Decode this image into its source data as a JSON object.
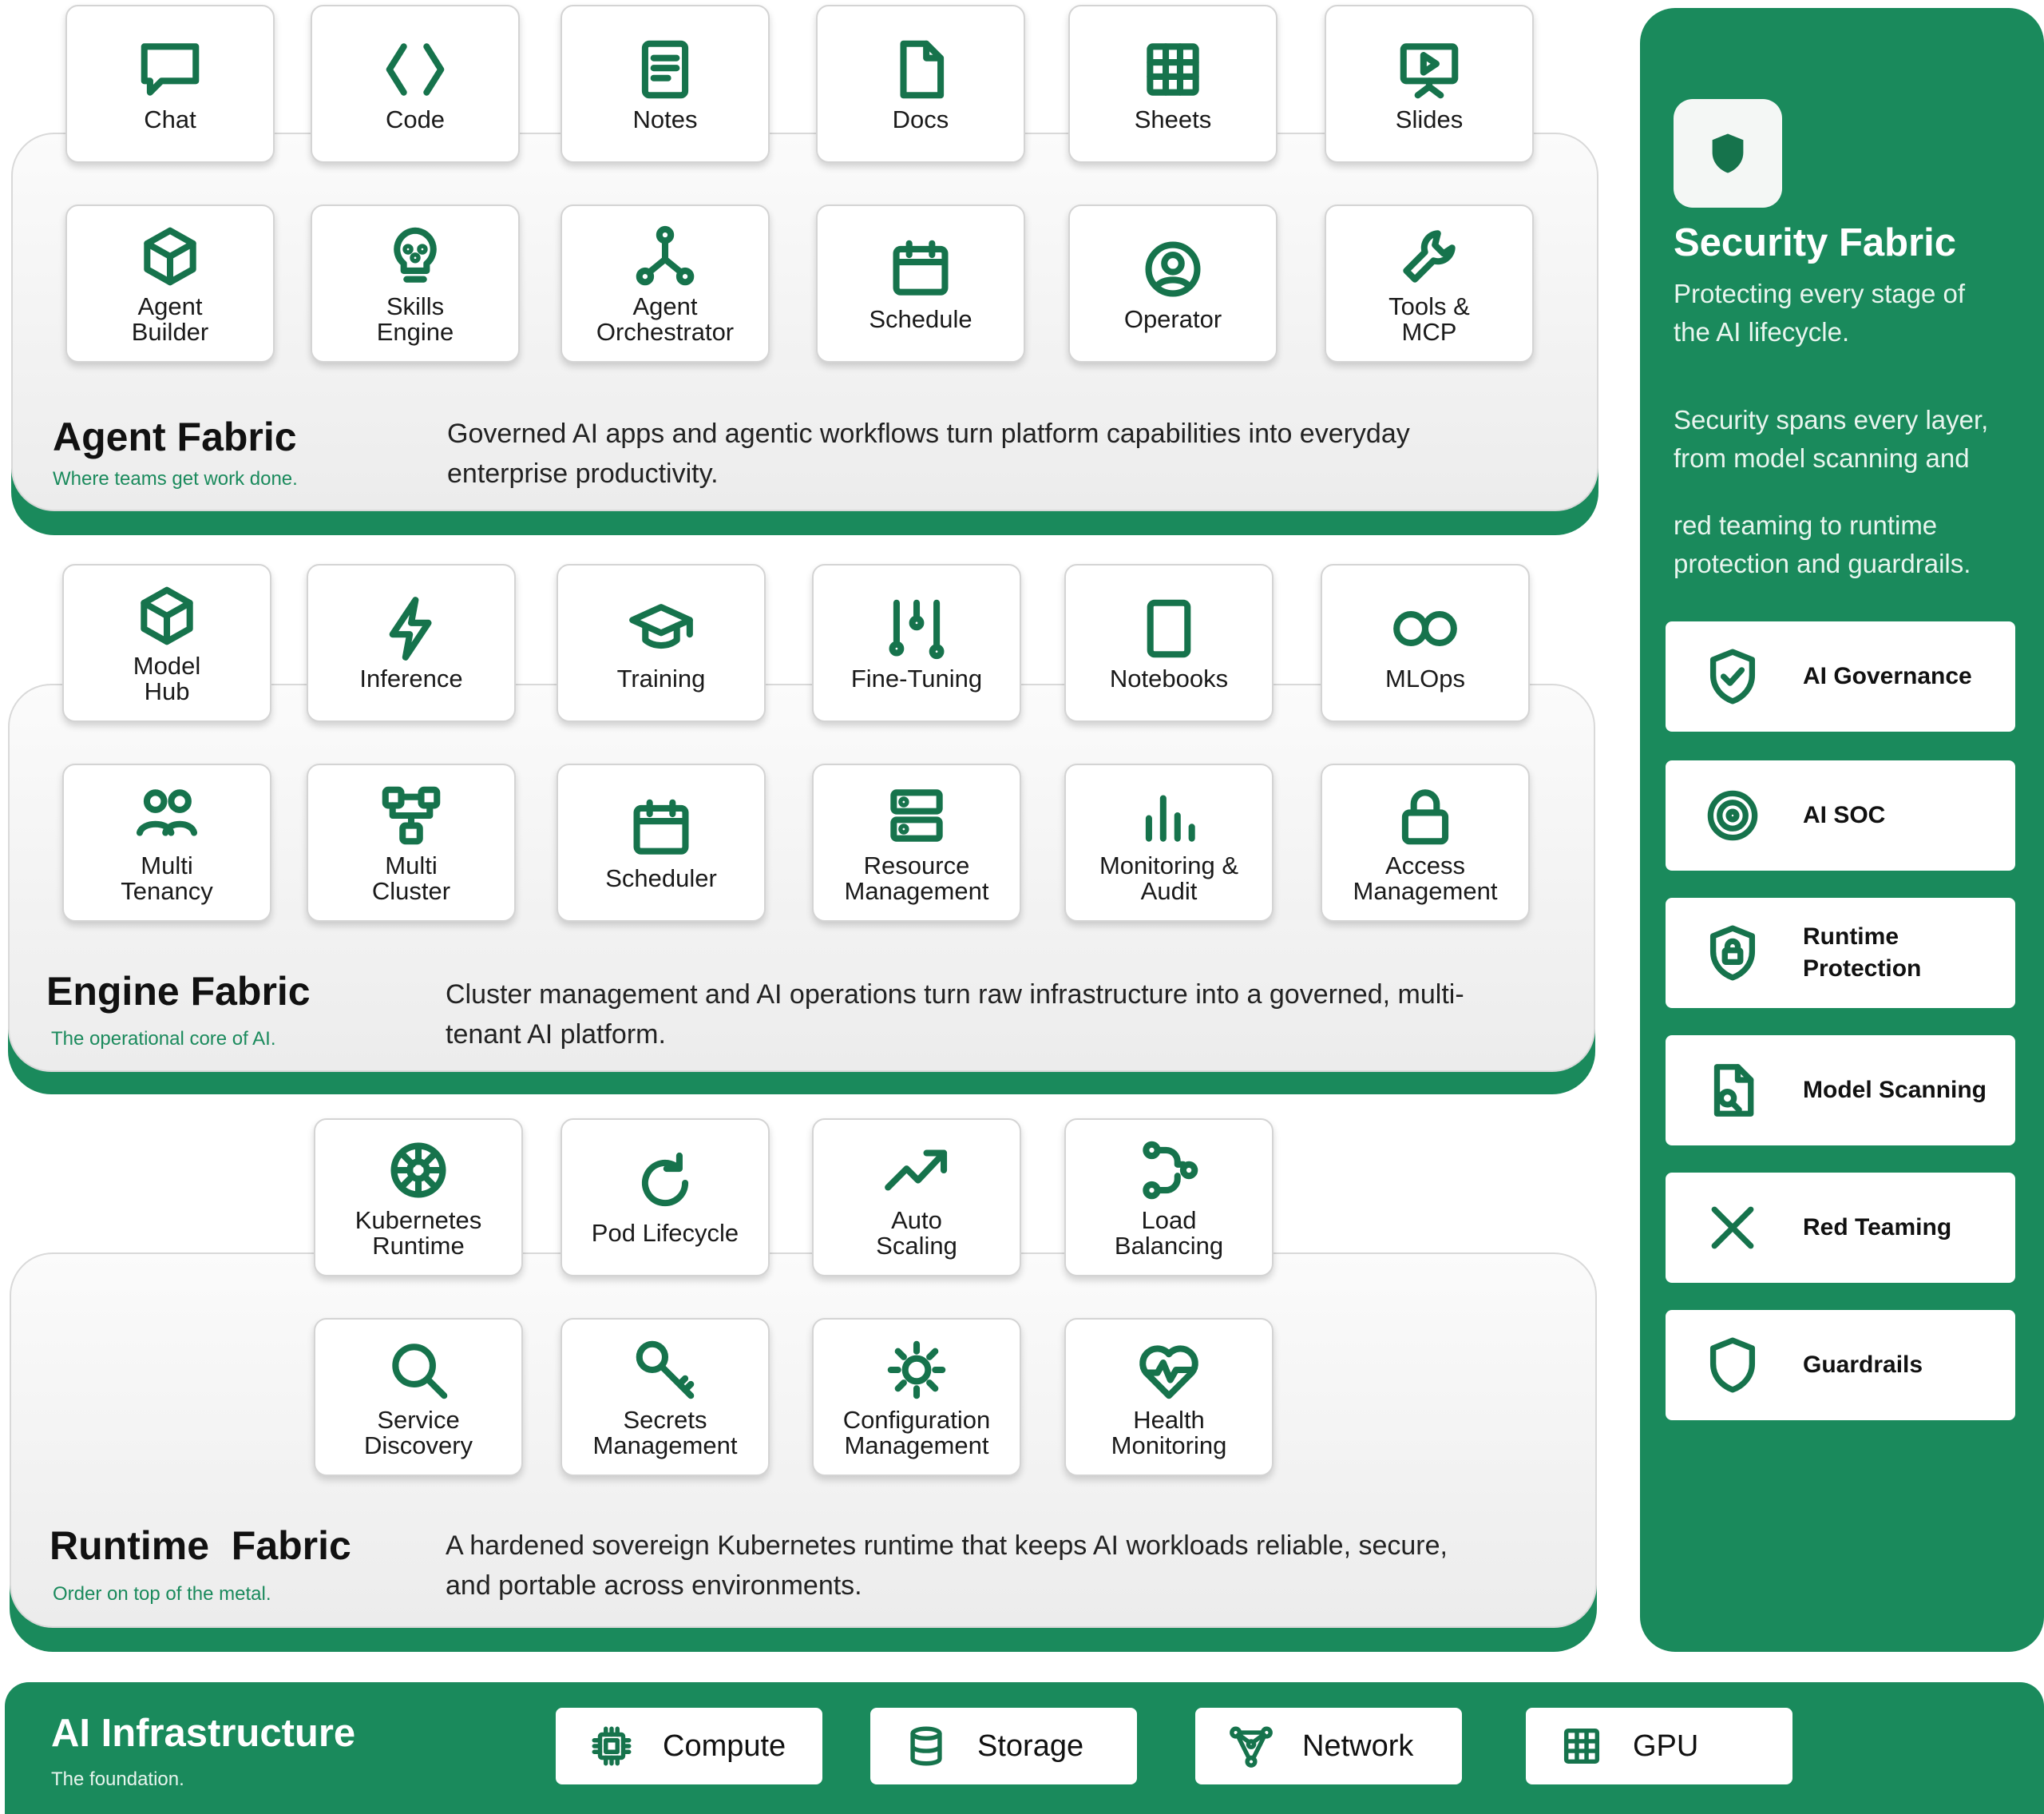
{
  "agent_fabric": {
    "title": "Agent Fabric",
    "subtitle": "Where teams get work done.",
    "description": "Governed AI apps and agentic workflows turn platform capabilities into everyday enterprise productivity.",
    "row1": [
      {
        "label": "Chat",
        "icon": "chat-icon"
      },
      {
        "label": "Code",
        "icon": "code-icon"
      },
      {
        "label": "Notes",
        "icon": "notes-icon"
      },
      {
        "label": "Docs",
        "icon": "document-icon"
      },
      {
        "label": "Sheets",
        "icon": "grid-icon"
      },
      {
        "label": "Slides",
        "icon": "presentation-icon"
      }
    ],
    "row2": [
      {
        "label": "Agent\nBuilder",
        "icon": "cube-icon"
      },
      {
        "label": "Skills\nEngine",
        "icon": "bulb-icon"
      },
      {
        "label": "Agent\nOrchestrator",
        "icon": "network-icon"
      },
      {
        "label": "Schedule",
        "icon": "calendar-icon"
      },
      {
        "label": "Operator",
        "icon": "user-circle-icon"
      },
      {
        "label": "Tools &\nMCP",
        "icon": "wrench-icon"
      }
    ]
  },
  "engine_fabric": {
    "title": "Engine Fabric",
    "subtitle": "The operational core of AI.",
    "description": "Cluster management and AI operations turn raw infrastructure into a governed, multi-tenant AI platform.",
    "row1": [
      {
        "label": "Model\nHub",
        "icon": "box-icon"
      },
      {
        "label": "Inference",
        "icon": "lightning-icon"
      },
      {
        "label": "Training",
        "icon": "graduation-cap-icon"
      },
      {
        "label": "Fine-Tuning",
        "icon": "sliders-icon"
      },
      {
        "label": "Notebooks",
        "icon": "notebook-icon"
      },
      {
        "label": "MLOps",
        "icon": "infinity-icon"
      }
    ],
    "row2": [
      {
        "label": "Multi\nTenancy",
        "icon": "users-icon"
      },
      {
        "label": "Multi\nCluster",
        "icon": "cluster-icon"
      },
      {
        "label": "Scheduler",
        "icon": "calendar-icon"
      },
      {
        "label": "Resource\nManagement",
        "icon": "server-icon"
      },
      {
        "label": "Monitoring &\nAudit",
        "icon": "bar-chart-icon"
      },
      {
        "label": "Access\nManagement",
        "icon": "lock-icon"
      }
    ]
  },
  "runtime_fabric": {
    "title": "Runtime  Fabric",
    "subtitle": "Order on top of the metal.",
    "description": "A hardened sovereign Kubernetes runtime that keeps AI workloads reliable, secure, and portable across environments.",
    "row1": [
      {
        "label": "Kubernetes\nRuntime",
        "icon": "helm-icon"
      },
      {
        "label": "Pod Lifecycle",
        "icon": "refresh-icon"
      },
      {
        "label": "Auto\nScaling",
        "icon": "trending-up-icon"
      },
      {
        "label": "Load\nBalancing",
        "icon": "route-icon"
      }
    ],
    "row2": [
      {
        "label": "Service\nDiscovery",
        "icon": "search-icon"
      },
      {
        "label": "Secrets\nManagement",
        "icon": "key-icon"
      },
      {
        "label": "Configuration\nManagement",
        "icon": "sun-gear-icon"
      },
      {
        "label": "Health\nMonitoring",
        "icon": "heart-pulse-icon"
      }
    ]
  },
  "security_fabric": {
    "title": "Security Fabric",
    "subtitle": "Protecting every stage of the AI lifecycle.",
    "description_1": "Security spans every layer, from model scanning and",
    "description_2": "red teaming to runtime protection and guardrails.",
    "items": [
      {
        "label": "AI Governance",
        "icon": "shield-check-icon"
      },
      {
        "label": "AI SOC",
        "icon": "target-icon"
      },
      {
        "label": "Runtime\nProtection",
        "icon": "shield-lock-icon"
      },
      {
        "label": "Model Scanning",
        "icon": "file-search-icon"
      },
      {
        "label": "Red Teaming",
        "icon": "cross-icon"
      },
      {
        "label": "Guardrails",
        "icon": "shield-icon"
      }
    ]
  },
  "ai_infrastructure": {
    "title": "AI Infrastructure",
    "subtitle": "The foundation.",
    "items": [
      {
        "label": "Compute",
        "icon": "chip-icon"
      },
      {
        "label": "Storage",
        "icon": "database-icon"
      },
      {
        "label": "Network",
        "icon": "network-nodes-icon"
      },
      {
        "label": "GPU",
        "icon": "gpu-grid-icon"
      }
    ]
  },
  "colors": {
    "brand_green": "#1a8a5c",
    "icon_green": "#16734c"
  }
}
